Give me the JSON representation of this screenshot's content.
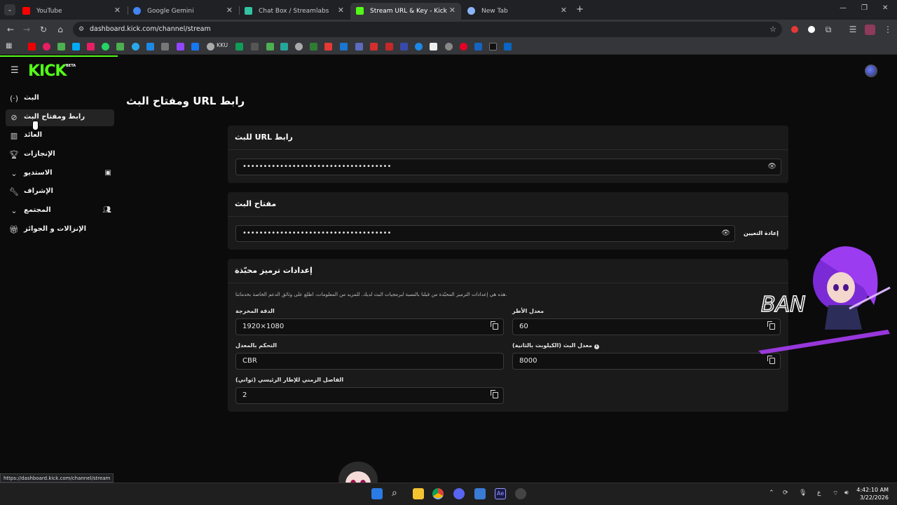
{
  "browser": {
    "tabs": [
      {
        "title": "YouTube",
        "active": false,
        "color": "#ff0000"
      },
      {
        "title": "Google Gemini",
        "active": false,
        "color": "#4285f4"
      },
      {
        "title": "Chat Box / Streamlabs",
        "active": false,
        "color": "#31c3a2"
      },
      {
        "title": "Stream URL & Key - Kick Dashb",
        "active": true,
        "color": "#53fc18"
      },
      {
        "title": "New Tab",
        "active": false,
        "color": "#8ab4f8"
      }
    ],
    "address": "dashboard.kick.com/channel/stream",
    "bookmark_label": "KKU",
    "status_url": "https://dashboard.kick.com/channel/stream"
  },
  "kick": {
    "logo": "KICK",
    "beta": "BETA",
    "accent": "#53fc18"
  },
  "sidebar": {
    "items": [
      {
        "label": "البث",
        "icon": "broadcast-icon"
      },
      {
        "label": "رابط ومفتاح البث",
        "icon": "link-icon",
        "active": true
      },
      {
        "label": "العائد",
        "icon": "chart-icon"
      },
      {
        "label": "الإنجازات",
        "icon": "trophy-icon"
      },
      {
        "label": "الاستديو",
        "icon": "chevron-down-icon"
      },
      {
        "label": "الإشراف",
        "icon": "wrench-icon"
      },
      {
        "label": "المجتمع",
        "icon": "chevron-down-icon"
      },
      {
        "label": "الإنزالات و الجوائز",
        "icon": "gift-icon"
      }
    ]
  },
  "main": {
    "title": "ومفتاح البث URL رابط",
    "stream_url": {
      "title": "للبث URL رابط",
      "value": "••••••••••••••••••••••••••••••••••••"
    },
    "stream_key": {
      "title": "مفتاح البث",
      "value": "••••••••••••••••••••••••••••••••••••",
      "reset_label": "إعادة التعيين"
    },
    "encoding": {
      "title": "إعدادات ترميز محبّذة",
      "description": ".هذه هي إعدادات الترميز المحبّذة من قبلنا بالنسبة لبرمجيات البث لديك. للمزيد من المعلومات، اطلع على وثائق الدعم الخاصة بخدماتنا",
      "resolution_label": "الدقة المخرجة",
      "resolution": "1920×1080",
      "framerate_label": "معدل الأطر",
      "framerate": "60",
      "rate_control_label": "التحكم بالمعدل",
      "rate_control": "CBR",
      "bitrate_label": "معدل البث (الكيلوبت بالثانية)",
      "bitrate": "8000",
      "keyframe_label": "الفاصل الزمني للإطار الرئيسي (ثواني)",
      "keyframe": "2"
    }
  },
  "overlay": {
    "ban_text": "BAN"
  },
  "taskbar": {
    "time": "4:42:10 AM",
    "date": "3/22/2026",
    "lang": "ع"
  }
}
